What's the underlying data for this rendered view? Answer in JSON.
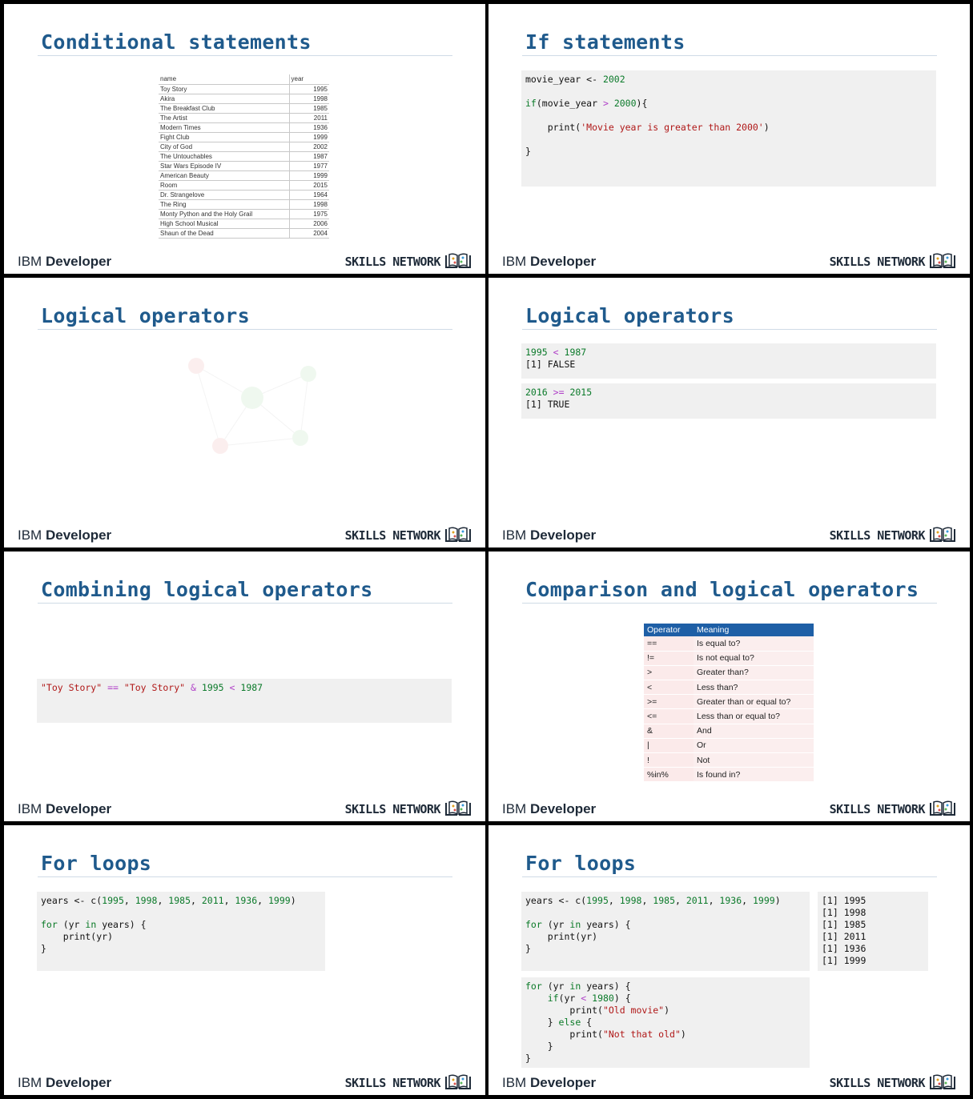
{
  "footer": {
    "brand_light": "IBM",
    "brand_bold": "Developer",
    "skills": "SKILLS NETWORK"
  },
  "slides": [
    {
      "title": "Conditional statements",
      "table": {
        "headers": [
          "name",
          "year"
        ],
        "rows": [
          [
            "Toy Story",
            "1995"
          ],
          [
            "Akira",
            "1998"
          ],
          [
            "The Breakfast Club",
            "1985"
          ],
          [
            "The Artist",
            "2011"
          ],
          [
            "Modern Times",
            "1936"
          ],
          [
            "Fight Club",
            "1999"
          ],
          [
            "City of God",
            "2002"
          ],
          [
            "The Untouchables",
            "1987"
          ],
          [
            "Star Wars Episode IV",
            "1977"
          ],
          [
            "American Beauty",
            "1999"
          ],
          [
            "Room",
            "2015"
          ],
          [
            "Dr. Strangelove",
            "1964"
          ],
          [
            "The Ring",
            "1998"
          ],
          [
            "Monty Python and the Holy Grail",
            "1975"
          ],
          [
            "High School Musical",
            "2006"
          ],
          [
            "Shaun of the Dead",
            "2004"
          ]
        ]
      }
    },
    {
      "title": "If statements",
      "code": [
        [
          {
            "t": "movie_year <- "
          },
          {
            "t": "2002",
            "c": "num"
          }
        ],
        [],
        [
          {
            "t": "if",
            "c": "kw"
          },
          {
            "t": "(movie_year "
          },
          {
            "t": ">",
            "c": "op"
          },
          {
            "t": " "
          },
          {
            "t": "2000",
            "c": "num"
          },
          {
            "t": "){"
          }
        ],
        [],
        [
          {
            "t": "    print("
          },
          {
            "t": "'Movie year is greater than 2000'",
            "c": "str"
          },
          {
            "t": ")"
          }
        ],
        [],
        [
          {
            "t": "}"
          }
        ]
      ]
    },
    {
      "title": "Logical operators"
    },
    {
      "title": "Logical operators",
      "blocks": [
        [
          [
            {
              "t": "1995",
              "c": "num"
            },
            {
              "t": " "
            },
            {
              "t": "<",
              "c": "op"
            },
            {
              "t": " "
            },
            {
              "t": "1987",
              "c": "num"
            }
          ],
          [
            {
              "t": "[1] FALSE"
            }
          ]
        ],
        [
          [
            {
              "t": "2016",
              "c": "num"
            },
            {
              "t": " "
            },
            {
              "t": ">=",
              "c": "op"
            },
            {
              "t": " "
            },
            {
              "t": "2015",
              "c": "num"
            }
          ],
          [
            {
              "t": "[1] TRUE"
            }
          ]
        ]
      ]
    },
    {
      "title": "Combining logical operators",
      "code": [
        [
          {
            "t": "\"Toy Story\"",
            "c": "str"
          },
          {
            "t": " "
          },
          {
            "t": "==",
            "c": "op"
          },
          {
            "t": " "
          },
          {
            "t": "\"Toy Story\"",
            "c": "str"
          },
          {
            "t": " "
          },
          {
            "t": "&",
            "c": "op"
          },
          {
            "t": " "
          },
          {
            "t": "1995",
            "c": "num"
          },
          {
            "t": " "
          },
          {
            "t": "<",
            "c": "op"
          },
          {
            "t": " "
          },
          {
            "t": "1987",
            "c": "num"
          }
        ]
      ]
    },
    {
      "title": "Comparison and logical operators",
      "table": {
        "headers": [
          "Operator",
          "Meaning"
        ],
        "rows": [
          [
            "==",
            "Is equal to?"
          ],
          [
            "!=",
            "Is not equal to?"
          ],
          [
            ">",
            "Greater than?"
          ],
          [
            "<",
            "Less than?"
          ],
          [
            ">=",
            "Greater than or equal to?"
          ],
          [
            "<=",
            "Less than or equal to?"
          ],
          [
            "&",
            "And"
          ],
          [
            "|",
            "Or"
          ],
          [
            "!",
            "Not"
          ],
          [
            "%in%",
            "Is found in?"
          ]
        ]
      }
    },
    {
      "title": "For loops",
      "code": [
        [
          {
            "t": "years <- c("
          },
          {
            "t": "1995",
            "c": "num"
          },
          {
            "t": ", "
          },
          {
            "t": "1998",
            "c": "num"
          },
          {
            "t": ", "
          },
          {
            "t": "1985",
            "c": "num"
          },
          {
            "t": ", "
          },
          {
            "t": "2011",
            "c": "num"
          },
          {
            "t": ", "
          },
          {
            "t": "1936",
            "c": "num"
          },
          {
            "t": ", "
          },
          {
            "t": "1999",
            "c": "num"
          },
          {
            "t": ")"
          }
        ],
        [],
        [
          {
            "t": "for",
            "c": "kw"
          },
          {
            "t": " (yr "
          },
          {
            "t": "in",
            "c": "kw"
          },
          {
            "t": " years) {"
          }
        ],
        [
          {
            "t": "    print(yr)"
          }
        ],
        [
          {
            "t": "}"
          }
        ]
      ]
    },
    {
      "title": "For loops",
      "code": [
        [
          {
            "t": "years <- c("
          },
          {
            "t": "1995",
            "c": "num"
          },
          {
            "t": ", "
          },
          {
            "t": "1998",
            "c": "num"
          },
          {
            "t": ", "
          },
          {
            "t": "1985",
            "c": "num"
          },
          {
            "t": ", "
          },
          {
            "t": "2011",
            "c": "num"
          },
          {
            "t": ", "
          },
          {
            "t": "1936",
            "c": "num"
          },
          {
            "t": ", "
          },
          {
            "t": "1999",
            "c": "num"
          },
          {
            "t": ")"
          }
        ],
        [],
        [
          {
            "t": "for",
            "c": "kw"
          },
          {
            "t": " (yr "
          },
          {
            "t": "in",
            "c": "kw"
          },
          {
            "t": " years) {"
          }
        ],
        [
          {
            "t": "    print(yr)"
          }
        ],
        [
          {
            "t": "}"
          }
        ]
      ],
      "output": [
        [
          {
            "t": "[1] 1995"
          }
        ],
        [
          {
            "t": "[1] 1998"
          }
        ],
        [
          {
            "t": "[1] 1985"
          }
        ],
        [
          {
            "t": "[1] 2011"
          }
        ],
        [
          {
            "t": "[1] 1936"
          }
        ],
        [
          {
            "t": "[1] 1999"
          }
        ]
      ],
      "code2": [
        [
          {
            "t": "for",
            "c": "kw"
          },
          {
            "t": " (yr "
          },
          {
            "t": "in",
            "c": "kw"
          },
          {
            "t": " years) {"
          }
        ],
        [
          {
            "t": "    "
          },
          {
            "t": "if",
            "c": "kw"
          },
          {
            "t": "(yr "
          },
          {
            "t": "<",
            "c": "op"
          },
          {
            "t": " "
          },
          {
            "t": "1980",
            "c": "num"
          },
          {
            "t": ") {"
          }
        ],
        [
          {
            "t": "        print("
          },
          {
            "t": "\"Old movie\"",
            "c": "str"
          },
          {
            "t": ")"
          }
        ],
        [
          {
            "t": "    } "
          },
          {
            "t": "else",
            "c": "kw"
          },
          {
            "t": " {"
          }
        ],
        [
          {
            "t": "        print("
          },
          {
            "t": "\"Not that old\"",
            "c": "str"
          },
          {
            "t": ")"
          }
        ],
        [
          {
            "t": "    }"
          }
        ],
        [
          {
            "t": "}"
          }
        ]
      ]
    }
  ]
}
